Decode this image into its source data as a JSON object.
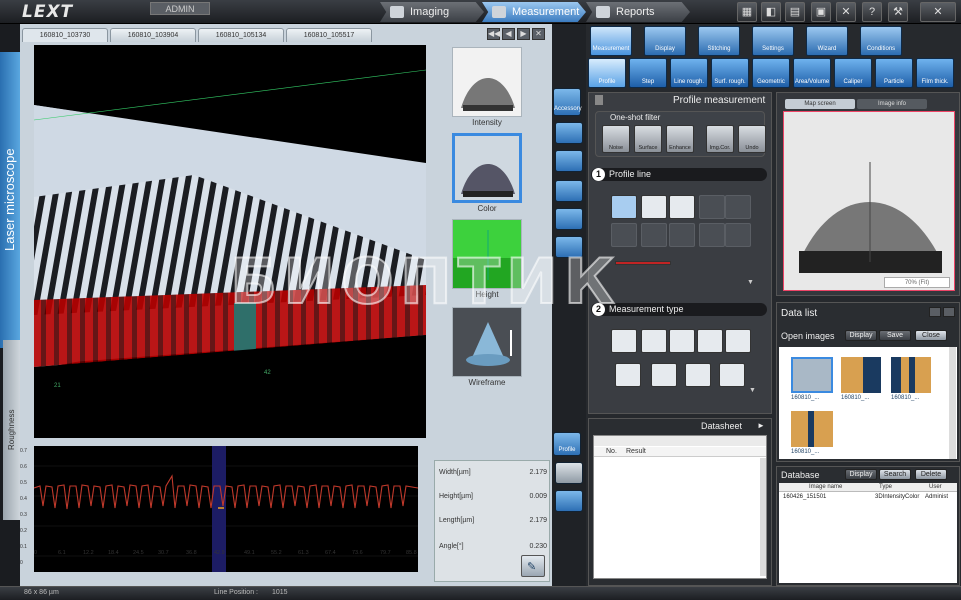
{
  "app": {
    "logo": "LEXT",
    "user": "ADMIN"
  },
  "main_tabs": [
    {
      "label": "Imaging"
    },
    {
      "label": "Measurement"
    },
    {
      "label": "Reports"
    }
  ],
  "side_labels": {
    "main": "Laser microscope",
    "sub": "Roughness"
  },
  "image_tabs": [
    "160810_103730",
    "160810_103904",
    "160810_105134",
    "160810_105517"
  ],
  "thumbnails": [
    {
      "label": "Intensity"
    },
    {
      "label": "Color"
    },
    {
      "label": "Height"
    },
    {
      "label": "Wireframe"
    }
  ],
  "view_axis": {
    "x": "21",
    "y": "42"
  },
  "profile_ticks": [
    "0",
    "6.1",
    "12.2",
    "18.4",
    "24.5",
    "30.7",
    "36.8",
    "42.9",
    "49.1",
    "55.2",
    "61.3",
    "67.4",
    "73.6",
    "79.7",
    "85.8"
  ],
  "profile_yticks": [
    "0.7",
    "0.6",
    "0.5",
    "0.4",
    "0.3",
    "0.2",
    "0.1",
    "0"
  ],
  "measurements": [
    {
      "label": "Width[µm]",
      "value": "2.179"
    },
    {
      "label": "Height[µm]",
      "value": "0.009"
    },
    {
      "label": "Length[µm]",
      "value": "2.179"
    },
    {
      "label": "Angle[°]",
      "value": "0.230"
    }
  ],
  "vsidebar": {
    "accessory": "Accessory",
    "profile": "Profile"
  },
  "categories": [
    "Measurement",
    "Display",
    "Stitching",
    "Settings",
    "Wizard",
    "Conditions"
  ],
  "subtools": [
    "Profile",
    "Step",
    "Line rough.",
    "Surf. rough.",
    "Geometric",
    "Area/Volume",
    "Caliper",
    "Particle",
    "Film thick."
  ],
  "profile_panel": {
    "title": "Profile measurement",
    "one_shot_filter": "One-shot filter",
    "filters": [
      "Noise",
      "Surface",
      "Enhance",
      "Img.Cor.",
      "Undo"
    ],
    "section1": "Profile line",
    "section2": "Measurement type"
  },
  "datasheet": {
    "title": "Datasheet",
    "col_no": "No.",
    "col_result": "Result"
  },
  "image_preview": {
    "tabs": [
      "Map screen",
      "Image info"
    ],
    "zoom": "70% (Fit)"
  },
  "data_list": {
    "title": "Data list",
    "open_images": "Open images",
    "display_btn": "Display",
    "save_btn": "Save",
    "close_btn": "Close",
    "images": [
      "160810_...",
      "160810_...",
      "160810_...",
      "160810_..."
    ]
  },
  "database": {
    "title": "Database",
    "display_btn": "Display",
    "search_btn": "Search",
    "delete_btn": "Delete",
    "columns": [
      "Image name",
      "Type",
      "User"
    ],
    "rows": [
      {
        "name": "160426_151501",
        "type": "3DIntensityColor",
        "user": "Administ"
      }
    ]
  },
  "status": {
    "size": "86 x 86 µm",
    "line_position_label": "Line Position :",
    "line_position": "1015"
  },
  "watermark": "БИОПТИК"
}
